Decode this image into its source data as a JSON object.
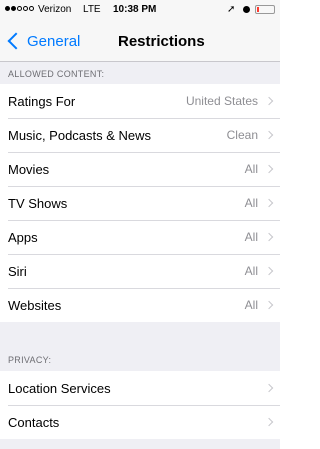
{
  "status_bar": {
    "carrier": "Verizon",
    "network": "LTE",
    "time": "10:38 PM",
    "signal_bars_filled": 2,
    "signal_bars_total": 5,
    "battery_level": 0.1,
    "battery_color": "#ff3b30"
  },
  "nav": {
    "back_label": "General",
    "title": "Restrictions"
  },
  "sections": {
    "allowed": {
      "header": "ALLOWED CONTENT:",
      "items": [
        {
          "label": "Ratings For",
          "value": "United States"
        },
        {
          "label": "Music, Podcasts & News",
          "value": "Clean"
        },
        {
          "label": "Movies",
          "value": "All"
        },
        {
          "label": "TV Shows",
          "value": "All"
        },
        {
          "label": "Apps",
          "value": "All"
        },
        {
          "label": "Siri",
          "value": "All"
        },
        {
          "label": "Websites",
          "value": "All"
        }
      ]
    },
    "privacy": {
      "header": "PRIVACY:",
      "items": [
        {
          "label": "Location Services",
          "value": ""
        },
        {
          "label": "Contacts",
          "value": ""
        }
      ]
    }
  },
  "colors": {
    "accent": "#007aff",
    "background": "#efeff4",
    "secondary_text": "#8e8e93"
  }
}
